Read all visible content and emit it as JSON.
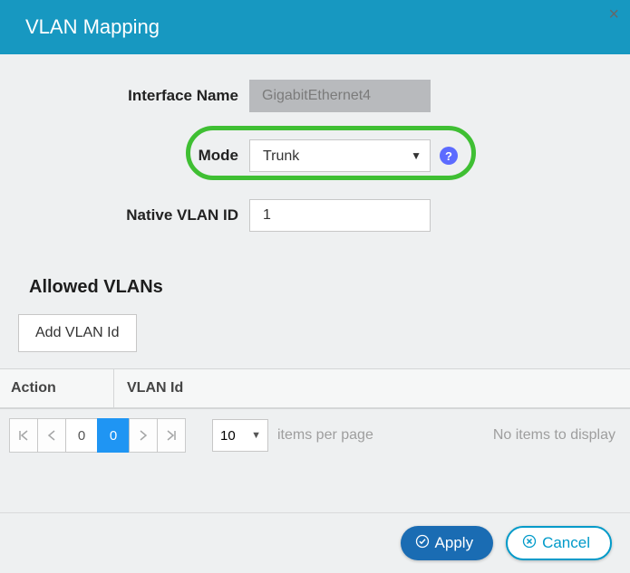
{
  "header": {
    "title": "VLAN Mapping"
  },
  "form": {
    "interface_label": "Interface Name",
    "interface_value": "GigabitEthernet4",
    "mode_label": "Mode",
    "mode_value": "Trunk",
    "native_vlan_label": "Native VLAN ID",
    "native_vlan_value": "1"
  },
  "allowed_vlans": {
    "section_title": "Allowed VLANs",
    "add_button": "Add VLAN Id",
    "columns": {
      "action": "Action",
      "vlan_id": "VLAN Id"
    },
    "rows": []
  },
  "pager": {
    "pages": [
      "0",
      "0"
    ],
    "active_index": 1,
    "items_per_page": "10",
    "items_per_page_label": "items per page",
    "empty_text": "No items to display"
  },
  "footer": {
    "apply": "Apply",
    "cancel": "Cancel"
  }
}
